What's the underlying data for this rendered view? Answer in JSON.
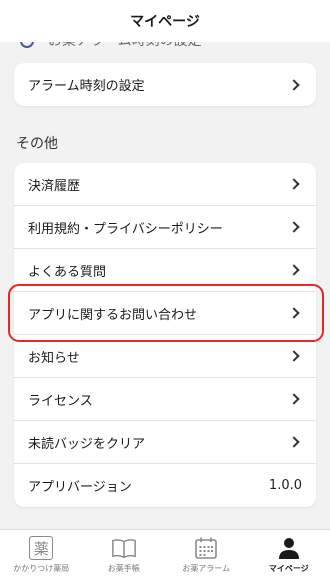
{
  "header": {
    "title": "マイページ"
  },
  "peek": {
    "text": "お薬アラーム時刻の設定"
  },
  "alarm_card": {
    "label": "アラーム時刻の設定"
  },
  "section": {
    "title": "その他"
  },
  "menu": [
    {
      "label": "決済履歴"
    },
    {
      "label": "利用規約・プライバシーポリシー"
    },
    {
      "label": "よくある質問"
    },
    {
      "label": "アプリに関するお問い合わせ"
    },
    {
      "label": "お知らせ"
    },
    {
      "label": "ライセンス"
    },
    {
      "label": "未読バッジをクリア"
    },
    {
      "label": "アプリバージョン",
      "value": "1.0.0"
    }
  ],
  "tabs": [
    {
      "label": "かかりつけ薬局",
      "glyph": "薬",
      "icon": "pharmacy-icon"
    },
    {
      "label": "お薬手帳",
      "icon": "book-icon"
    },
    {
      "label": "お薬アラーム",
      "icon": "calendar-icon"
    },
    {
      "label": "マイページ",
      "icon": "person-icon"
    }
  ],
  "colors": {
    "highlight": "#e8262b",
    "background": "#f2f2f2"
  }
}
